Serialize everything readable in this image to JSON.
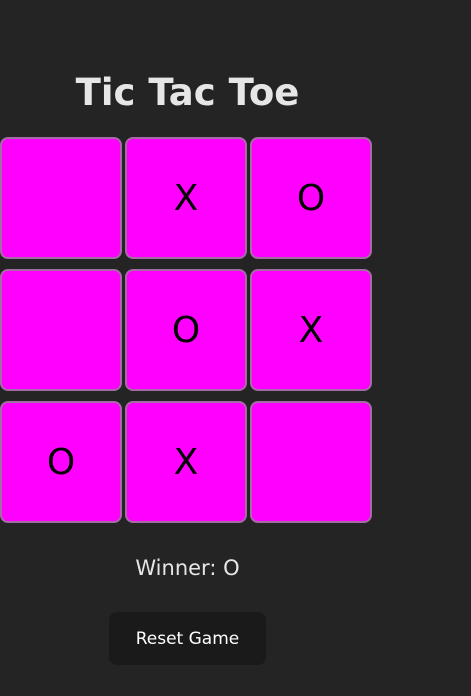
{
  "title": "Tic Tac Toe",
  "board": {
    "cells": [
      "",
      "X",
      "O",
      "",
      "O",
      "X",
      "O",
      "X",
      ""
    ]
  },
  "status": "Winner: O",
  "reset_label": "Reset Game",
  "colors": {
    "background": "#242424",
    "cell": "#ff00ff",
    "cell_border": "#a46ba4",
    "button": "#1a1a1a",
    "text": "#e6e6e6"
  }
}
